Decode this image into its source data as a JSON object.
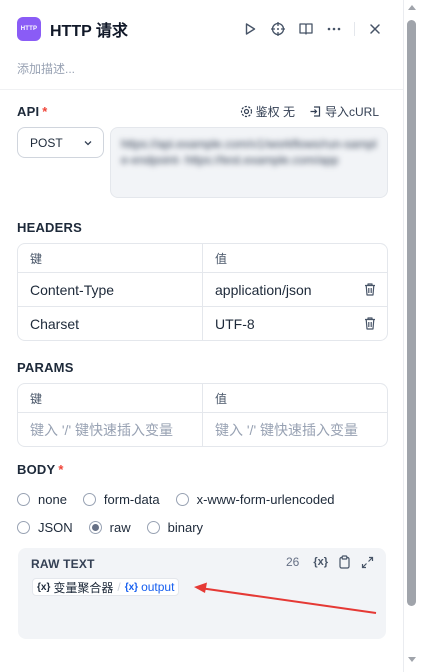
{
  "header": {
    "app_icon_text": "HTTP",
    "title": "HTTP 请求",
    "icons": [
      "play-icon",
      "target-icon",
      "book-icon",
      "more-icon",
      "close-icon"
    ]
  },
  "description_placeholder": "添加描述...",
  "api": {
    "label": "API",
    "required_mark": "*",
    "auth_label": "鉴权 无",
    "import_label": "导入cURL",
    "method": "POST",
    "url_text": "https://api.example.com/v1/workflows/run-sample-endpoint-\nhttps://test.example.com/app"
  },
  "headers": {
    "label": "HEADERS",
    "col_key": "键",
    "col_value": "值",
    "rows": [
      {
        "key": "Content-Type",
        "value": "application/json"
      },
      {
        "key": "Charset",
        "value": "UTF-8"
      }
    ]
  },
  "params": {
    "label": "PARAMS",
    "col_key": "键",
    "col_value": "值",
    "key_placeholder": "键入 '/' 键快速插入变量",
    "value_placeholder": "键入 '/' 键快速插入变量"
  },
  "body": {
    "label": "BODY",
    "required_mark": "*",
    "options": [
      "none",
      "form-data",
      "x-www-form-urlencoded",
      "JSON",
      "raw",
      "binary"
    ],
    "selected": "raw"
  },
  "raw_text": {
    "title": "RAW TEXT",
    "char_count": "26",
    "variable_icon_text": "{x}",
    "node_name": "变量聚合器",
    "separator": "/",
    "output_name": "output"
  },
  "colors": {
    "accent": "#8a5cf6",
    "link": "#155eef",
    "required": "#f04438",
    "annotation_arrow": "#e53935"
  }
}
